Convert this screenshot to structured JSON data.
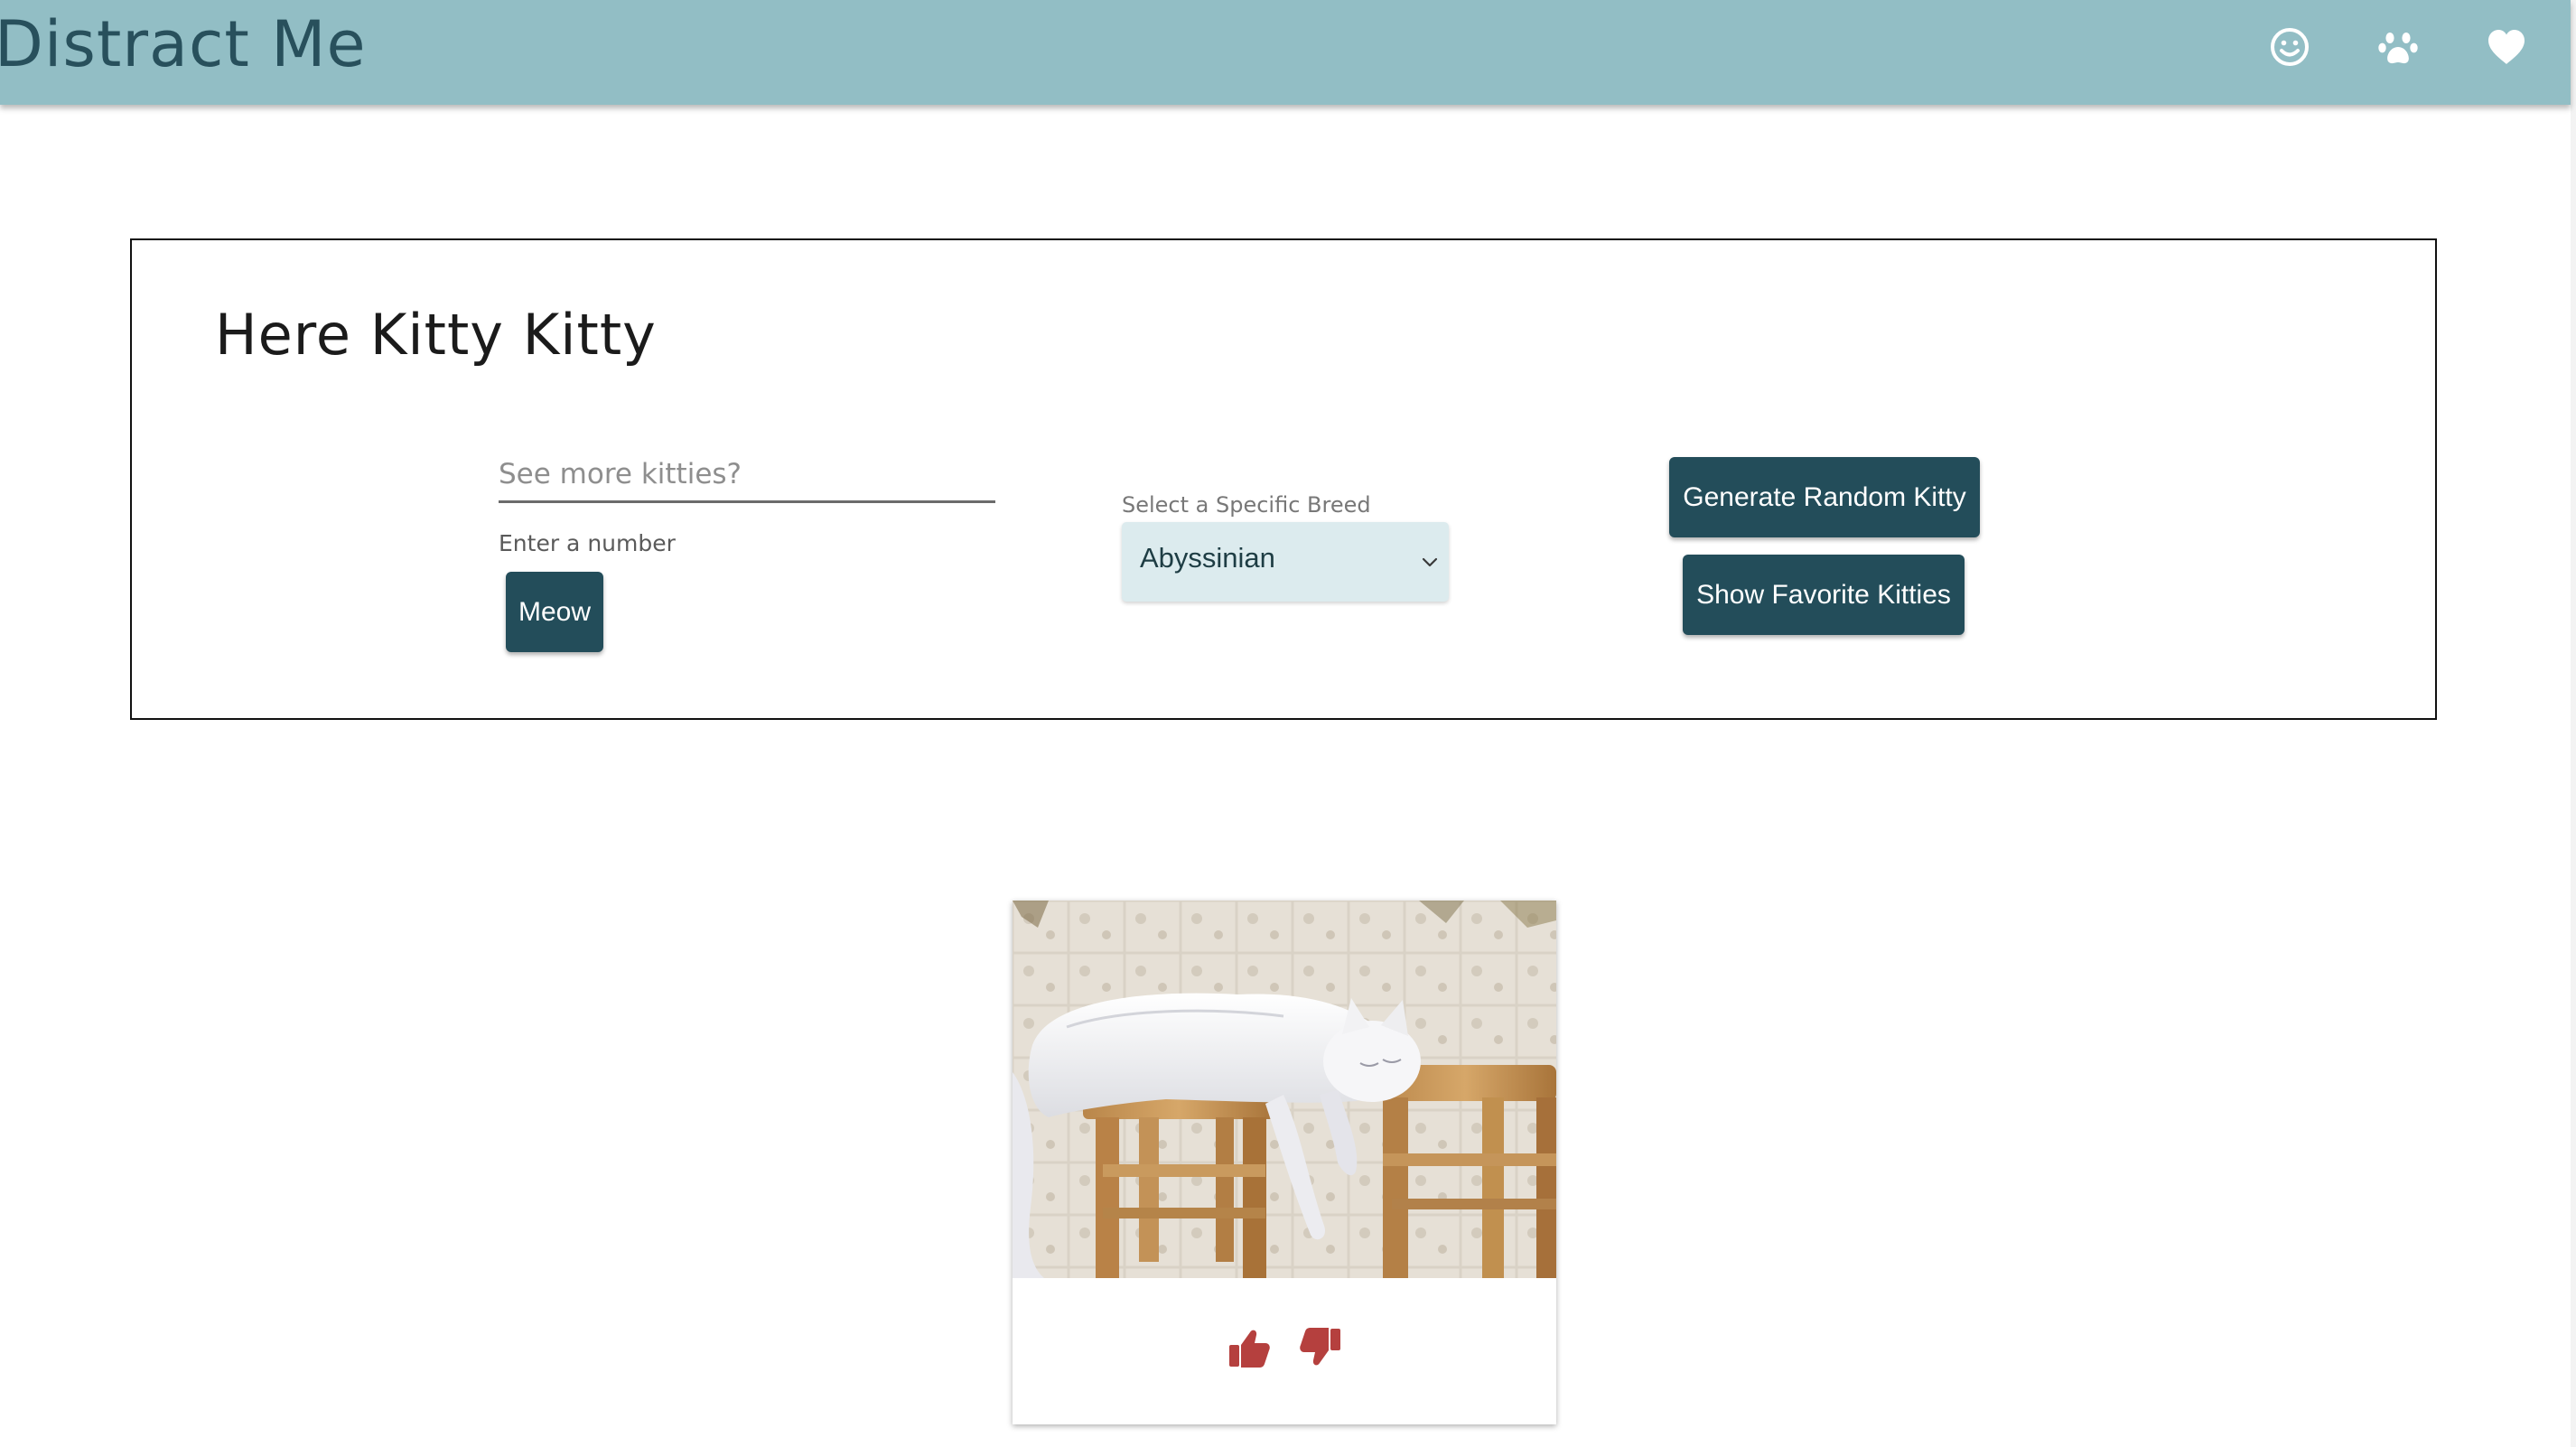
{
  "app": {
    "title": "Distract Me"
  },
  "nav": {
    "icons": [
      "smile-icon",
      "paw-icon",
      "heart-icon"
    ]
  },
  "panel": {
    "title": "Here Kitty Kitty",
    "count_input": {
      "placeholder": "See more kitties?",
      "value": "",
      "helper": "Enter a number"
    },
    "meow_label": "Meow",
    "breed_select": {
      "label": "Select a Specific Breed",
      "selected": "Abyssinian"
    },
    "random_label": "Generate Random Kitty",
    "favorites_label": "Show Favorite Kitties"
  },
  "card": {
    "actions": [
      "thumbs-up-icon",
      "thumbs-down-icon"
    ]
  },
  "colors": {
    "appbar": "#92bec5",
    "title": "#28505c",
    "button": "#234d5a",
    "select_bg": "#dcebee",
    "vote_icon": "#b5403e"
  }
}
